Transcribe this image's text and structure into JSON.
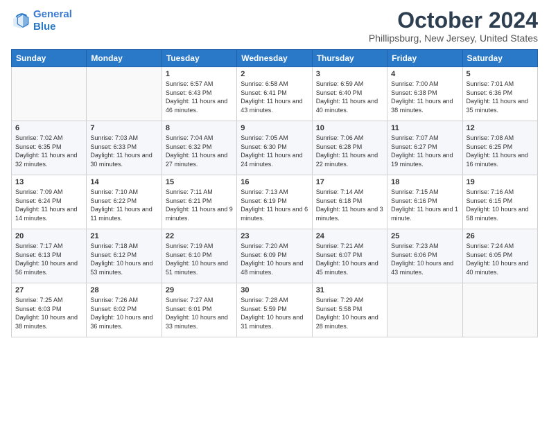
{
  "header": {
    "logo_line1": "General",
    "logo_line2": "Blue",
    "title": "October 2024",
    "subtitle": "Phillipsburg, New Jersey, United States"
  },
  "days_of_week": [
    "Sunday",
    "Monday",
    "Tuesday",
    "Wednesday",
    "Thursday",
    "Friday",
    "Saturday"
  ],
  "weeks": [
    [
      {
        "num": "",
        "sunrise": "",
        "sunset": "",
        "daylight": ""
      },
      {
        "num": "",
        "sunrise": "",
        "sunset": "",
        "daylight": ""
      },
      {
        "num": "1",
        "sunrise": "Sunrise: 6:57 AM",
        "sunset": "Sunset: 6:43 PM",
        "daylight": "Daylight: 11 hours and 46 minutes."
      },
      {
        "num": "2",
        "sunrise": "Sunrise: 6:58 AM",
        "sunset": "Sunset: 6:41 PM",
        "daylight": "Daylight: 11 hours and 43 minutes."
      },
      {
        "num": "3",
        "sunrise": "Sunrise: 6:59 AM",
        "sunset": "Sunset: 6:40 PM",
        "daylight": "Daylight: 11 hours and 40 minutes."
      },
      {
        "num": "4",
        "sunrise": "Sunrise: 7:00 AM",
        "sunset": "Sunset: 6:38 PM",
        "daylight": "Daylight: 11 hours and 38 minutes."
      },
      {
        "num": "5",
        "sunrise": "Sunrise: 7:01 AM",
        "sunset": "Sunset: 6:36 PM",
        "daylight": "Daylight: 11 hours and 35 minutes."
      }
    ],
    [
      {
        "num": "6",
        "sunrise": "Sunrise: 7:02 AM",
        "sunset": "Sunset: 6:35 PM",
        "daylight": "Daylight: 11 hours and 32 minutes."
      },
      {
        "num": "7",
        "sunrise": "Sunrise: 7:03 AM",
        "sunset": "Sunset: 6:33 PM",
        "daylight": "Daylight: 11 hours and 30 minutes."
      },
      {
        "num": "8",
        "sunrise": "Sunrise: 7:04 AM",
        "sunset": "Sunset: 6:32 PM",
        "daylight": "Daylight: 11 hours and 27 minutes."
      },
      {
        "num": "9",
        "sunrise": "Sunrise: 7:05 AM",
        "sunset": "Sunset: 6:30 PM",
        "daylight": "Daylight: 11 hours and 24 minutes."
      },
      {
        "num": "10",
        "sunrise": "Sunrise: 7:06 AM",
        "sunset": "Sunset: 6:28 PM",
        "daylight": "Daylight: 11 hours and 22 minutes."
      },
      {
        "num": "11",
        "sunrise": "Sunrise: 7:07 AM",
        "sunset": "Sunset: 6:27 PM",
        "daylight": "Daylight: 11 hours and 19 minutes."
      },
      {
        "num": "12",
        "sunrise": "Sunrise: 7:08 AM",
        "sunset": "Sunset: 6:25 PM",
        "daylight": "Daylight: 11 hours and 16 minutes."
      }
    ],
    [
      {
        "num": "13",
        "sunrise": "Sunrise: 7:09 AM",
        "sunset": "Sunset: 6:24 PM",
        "daylight": "Daylight: 11 hours and 14 minutes."
      },
      {
        "num": "14",
        "sunrise": "Sunrise: 7:10 AM",
        "sunset": "Sunset: 6:22 PM",
        "daylight": "Daylight: 11 hours and 11 minutes."
      },
      {
        "num": "15",
        "sunrise": "Sunrise: 7:11 AM",
        "sunset": "Sunset: 6:21 PM",
        "daylight": "Daylight: 11 hours and 9 minutes."
      },
      {
        "num": "16",
        "sunrise": "Sunrise: 7:13 AM",
        "sunset": "Sunset: 6:19 PM",
        "daylight": "Daylight: 11 hours and 6 minutes."
      },
      {
        "num": "17",
        "sunrise": "Sunrise: 7:14 AM",
        "sunset": "Sunset: 6:18 PM",
        "daylight": "Daylight: 11 hours and 3 minutes."
      },
      {
        "num": "18",
        "sunrise": "Sunrise: 7:15 AM",
        "sunset": "Sunset: 6:16 PM",
        "daylight": "Daylight: 11 hours and 1 minute."
      },
      {
        "num": "19",
        "sunrise": "Sunrise: 7:16 AM",
        "sunset": "Sunset: 6:15 PM",
        "daylight": "Daylight: 10 hours and 58 minutes."
      }
    ],
    [
      {
        "num": "20",
        "sunrise": "Sunrise: 7:17 AM",
        "sunset": "Sunset: 6:13 PM",
        "daylight": "Daylight: 10 hours and 56 minutes."
      },
      {
        "num": "21",
        "sunrise": "Sunrise: 7:18 AM",
        "sunset": "Sunset: 6:12 PM",
        "daylight": "Daylight: 10 hours and 53 minutes."
      },
      {
        "num": "22",
        "sunrise": "Sunrise: 7:19 AM",
        "sunset": "Sunset: 6:10 PM",
        "daylight": "Daylight: 10 hours and 51 minutes."
      },
      {
        "num": "23",
        "sunrise": "Sunrise: 7:20 AM",
        "sunset": "Sunset: 6:09 PM",
        "daylight": "Daylight: 10 hours and 48 minutes."
      },
      {
        "num": "24",
        "sunrise": "Sunrise: 7:21 AM",
        "sunset": "Sunset: 6:07 PM",
        "daylight": "Daylight: 10 hours and 45 minutes."
      },
      {
        "num": "25",
        "sunrise": "Sunrise: 7:23 AM",
        "sunset": "Sunset: 6:06 PM",
        "daylight": "Daylight: 10 hours and 43 minutes."
      },
      {
        "num": "26",
        "sunrise": "Sunrise: 7:24 AM",
        "sunset": "Sunset: 6:05 PM",
        "daylight": "Daylight: 10 hours and 40 minutes."
      }
    ],
    [
      {
        "num": "27",
        "sunrise": "Sunrise: 7:25 AM",
        "sunset": "Sunset: 6:03 PM",
        "daylight": "Daylight: 10 hours and 38 minutes."
      },
      {
        "num": "28",
        "sunrise": "Sunrise: 7:26 AM",
        "sunset": "Sunset: 6:02 PM",
        "daylight": "Daylight: 10 hours and 36 minutes."
      },
      {
        "num": "29",
        "sunrise": "Sunrise: 7:27 AM",
        "sunset": "Sunset: 6:01 PM",
        "daylight": "Daylight: 10 hours and 33 minutes."
      },
      {
        "num": "30",
        "sunrise": "Sunrise: 7:28 AM",
        "sunset": "Sunset: 5:59 PM",
        "daylight": "Daylight: 10 hours and 31 minutes."
      },
      {
        "num": "31",
        "sunrise": "Sunrise: 7:29 AM",
        "sunset": "Sunset: 5:58 PM",
        "daylight": "Daylight: 10 hours and 28 minutes."
      },
      {
        "num": "",
        "sunrise": "",
        "sunset": "",
        "daylight": ""
      },
      {
        "num": "",
        "sunrise": "",
        "sunset": "",
        "daylight": ""
      }
    ]
  ]
}
